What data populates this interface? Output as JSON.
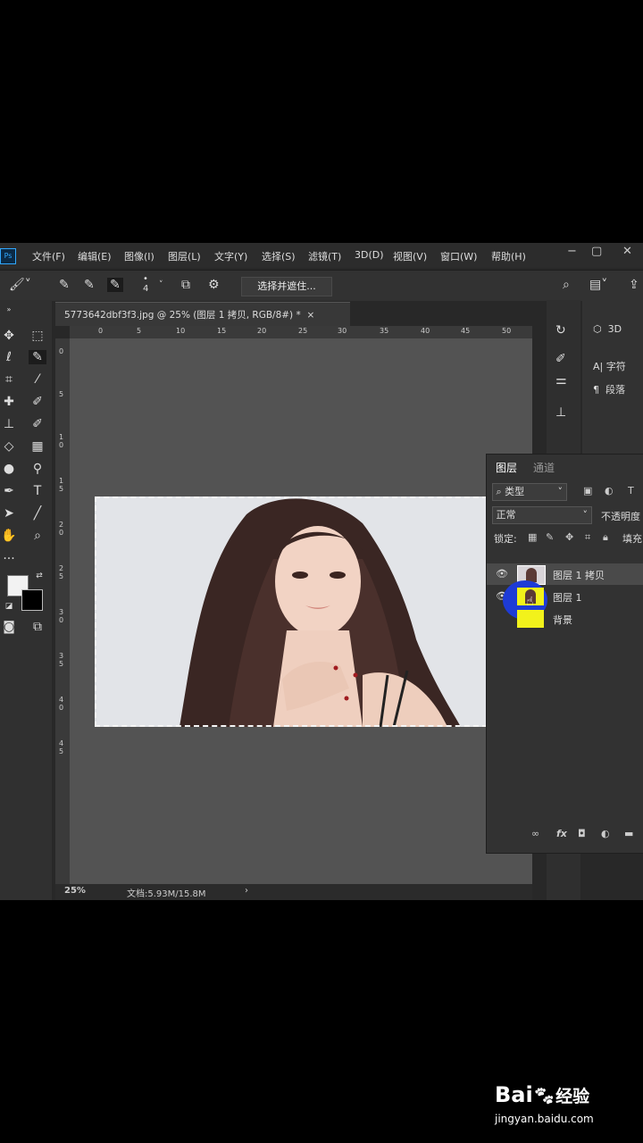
{
  "app": {
    "logo": "Ps"
  },
  "menu": [
    "文件(F)",
    "编辑(E)",
    "图像(I)",
    "图层(L)",
    "文字(Y)",
    "选择(S)",
    "滤镜(T)",
    "3D(D)",
    "视图(V)",
    "窗口(W)",
    "帮助(H)"
  ],
  "window_controls": {
    "minimize": "−",
    "restore": "▢",
    "close": "✕"
  },
  "options_bar": {
    "brush_size": "4",
    "select_mask_button": "选择并遮住..."
  },
  "document_tab": {
    "title": "5773642dbf3f3.jpg @ 25% (图层 1 拷贝, RGB/8#) *",
    "close": "×"
  },
  "ruler": {
    "h_ticks": [
      "0",
      "5",
      "10",
      "15",
      "20",
      "25",
      "30",
      "35",
      "40",
      "45",
      "50"
    ],
    "v_ticks": [
      "0",
      "5",
      "1 0",
      "1 5",
      "2 0",
      "2 5",
      "3 0",
      "3 5",
      "4 0",
      "4 5"
    ]
  },
  "status": {
    "zoom": "25%",
    "doc_info": "文档:5.93M/15.8M",
    "arrow": "›"
  },
  "right_dock": {
    "panel_3d": "3D",
    "panel_char": "字符",
    "panel_para": "段落"
  },
  "layers_panel": {
    "tabs": [
      "图层",
      "通道"
    ],
    "filter_kind": "类型",
    "blend_mode": "正常",
    "opacity_label": "不透明度",
    "lock_label": "锁定:",
    "fill_label": "填充",
    "layers": [
      {
        "name": "图层 1 拷贝",
        "visible": true,
        "selected": true
      },
      {
        "name": "图层 1",
        "visible": true,
        "selected": false
      },
      {
        "name": "背景",
        "visible": false,
        "selected": false
      }
    ],
    "bottom_icons": [
      "link-icon",
      "fx-icon",
      "mask-icon",
      "adjustment-icon",
      "folder-icon"
    ],
    "fx_text": "fx"
  },
  "watermark": {
    "brand_a": "Bai",
    "brand_b": "经验",
    "url": "jingyan.baidu.com"
  },
  "colors": {
    "accent": "#31a8ff",
    "panel": "#323232",
    "canvas": "#535353",
    "highlight_blue": "#1e3bd6",
    "thumb_yellow": "#f2f21b"
  }
}
